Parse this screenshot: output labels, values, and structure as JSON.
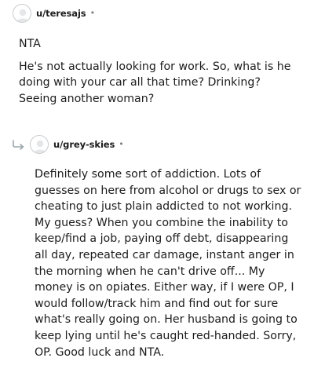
{
  "comments": [
    {
      "username": "u/teresajs",
      "separator": "•",
      "paragraphs": [
        "NTA",
        "He's not actually looking for work. So, what is he doing with your car all that time? Drinking? Seeing another woman?"
      ]
    },
    {
      "username": "u/grey-skies",
      "separator": "•",
      "paragraphs": [
        "Definitely some sort of addiction. Lots of guesses on here from alcohol or drugs to sex or cheating to just plain addicted to not working. My guess? When you combine the inability to keep/find a job, paying off debt, disappearing all day, repeated car damage, instant anger in the morning when he can't drive off... My money is on opiates. Either way, if I were OP, I would follow/track him and find out for sure what's really going on. Her husband is going to keep lying until he's caught red-handed. Sorry, OP. Good luck and NTA."
      ]
    }
  ],
  "icons": {
    "avatar": "user-avatar-icon",
    "reply": "reply-arrow-icon"
  },
  "colors": {
    "text": "#1c1c1c",
    "meta": "#7c7c7c",
    "avatar_border": "#c8cbcd",
    "reply_arrow": "#9aa5ab"
  }
}
